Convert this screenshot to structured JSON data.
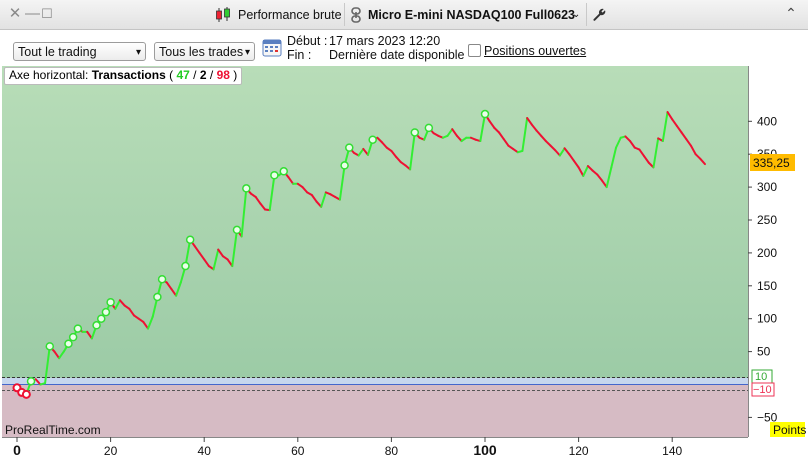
{
  "window": {
    "title": "Performance brute",
    "instrument": "Micro E-mini NASDAQ100 Full0623",
    "controls": [
      "close",
      "minimize",
      "maximize"
    ]
  },
  "toolbar": {
    "trading_select": "Tout le trading",
    "trades_select": "Tous les trades",
    "start_label": "Début :",
    "start_value": "17 mars 2023 12:20",
    "end_label": "Fin :",
    "end_value": "Dernière date disponible",
    "open_positions_label": "Positions ouvertes",
    "open_positions_checked": false
  },
  "chart_header": {
    "label": "Axe horizontal:",
    "mode": "Transactions",
    "paren_open": "(",
    "winners": "47",
    "slash1": "/",
    "neutral": "2",
    "slash2": "/",
    "losers": "98",
    "paren_close": ")"
  },
  "watermark": "ProRealTime.com",
  "units_badge": "Points",
  "colors": {
    "win": "#33ee33",
    "loss": "#ee1133",
    "profit_zone": "#b6ddb6",
    "loss_zone": "#d8bcc4",
    "price_badge": "#ffbb00",
    "units_badge": "#ffff00"
  },
  "chart_data": {
    "type": "line",
    "x_unit": "transactions",
    "y_unit": "Points",
    "current_value_label": "335,25",
    "threshold_labels": [
      "10",
      "−10"
    ],
    "thresholds": [
      10,
      -10
    ],
    "xlim": [
      -2,
      155
    ],
    "ylim": [
      -66,
      455
    ],
    "x_ticks": [
      0,
      20,
      40,
      60,
      80,
      100,
      120,
      140
    ],
    "x_tick_labels": [
      "0",
      "20",
      "40",
      "60",
      "80",
      "100",
      "120",
      "140"
    ],
    "bold_x_ticks": [
      0,
      100
    ],
    "y_ticks": [
      -50,
      50,
      100,
      150,
      200,
      250,
      300,
      350,
      400
    ],
    "y_tick_labels": [
      "−50",
      "50",
      "100",
      "150",
      "200",
      "250",
      "300",
      "350",
      "400"
    ],
    "equity": [
      [
        0,
        -5
      ],
      [
        1,
        -12
      ],
      [
        2,
        -15
      ],
      [
        3,
        5
      ],
      [
        4,
        8
      ],
      [
        5,
        0
      ],
      [
        6,
        2
      ],
      [
        7,
        58
      ],
      [
        8,
        50
      ],
      [
        9,
        40
      ],
      [
        10,
        50
      ],
      [
        11,
        62
      ],
      [
        12,
        72
      ],
      [
        13,
        85
      ],
      [
        14,
        80
      ],
      [
        15,
        80
      ],
      [
        16,
        70
      ],
      [
        17,
        90
      ],
      [
        18,
        100
      ],
      [
        19,
        110
      ],
      [
        20,
        125
      ],
      [
        21,
        115
      ],
      [
        22,
        128
      ],
      [
        23,
        120
      ],
      [
        24,
        115
      ],
      [
        25,
        105
      ],
      [
        26,
        100
      ],
      [
        27,
        95
      ],
      [
        28,
        85
      ],
      [
        29,
        103
      ],
      [
        30,
        133
      ],
      [
        31,
        160
      ],
      [
        32,
        155
      ],
      [
        33,
        145
      ],
      [
        34,
        135
      ],
      [
        35,
        155
      ],
      [
        36,
        180
      ],
      [
        37,
        220
      ],
      [
        38,
        210
      ],
      [
        39,
        200
      ],
      [
        40,
        190
      ],
      [
        41,
        180
      ],
      [
        42,
        175
      ],
      [
        43,
        205
      ],
      [
        44,
        195
      ],
      [
        45,
        190
      ],
      [
        46,
        180
      ],
      [
        47,
        235
      ],
      [
        48,
        225
      ],
      [
        49,
        298
      ],
      [
        50,
        290
      ],
      [
        51,
        285
      ],
      [
        52,
        275
      ],
      [
        53,
        266
      ],
      [
        54,
        265
      ],
      [
        55,
        318
      ],
      [
        56,
        318
      ],
      [
        57,
        324
      ],
      [
        58,
        315
      ],
      [
        59,
        305
      ],
      [
        60,
        305
      ],
      [
        61,
        300
      ],
      [
        62,
        292
      ],
      [
        63,
        288
      ],
      [
        64,
        278
      ],
      [
        65,
        270
      ],
      [
        66,
        292
      ],
      [
        67,
        289
      ],
      [
        68,
        285
      ],
      [
        69,
        281
      ],
      [
        70,
        333
      ],
      [
        71,
        360
      ],
      [
        72,
        352
      ],
      [
        73,
        348
      ],
      [
        74,
        358
      ],
      [
        75,
        349
      ],
      [
        76,
        372
      ],
      [
        77,
        375
      ],
      [
        78,
        368
      ],
      [
        79,
        360
      ],
      [
        80,
        355
      ],
      [
        81,
        346
      ],
      [
        82,
        338
      ],
      [
        83,
        333
      ],
      [
        84,
        327
      ],
      [
        85,
        383
      ],
      [
        86,
        375
      ],
      [
        87,
        372
      ],
      [
        88,
        390
      ],
      [
        89,
        382
      ],
      [
        90,
        378
      ],
      [
        91,
        375
      ],
      [
        92,
        378
      ],
      [
        93,
        388
      ],
      [
        94,
        378
      ],
      [
        95,
        370
      ],
      [
        96,
        375
      ],
      [
        97,
        375
      ],
      [
        98,
        372
      ],
      [
        99,
        370
      ],
      [
        100,
        411
      ],
      [
        101,
        400
      ],
      [
        102,
        390
      ],
      [
        103,
        383
      ],
      [
        104,
        373
      ],
      [
        105,
        363
      ],
      [
        106,
        358
      ],
      [
        107,
        353
      ],
      [
        108,
        355
      ],
      [
        109,
        405
      ],
      [
        110,
        395
      ],
      [
        111,
        386
      ],
      [
        112,
        378
      ],
      [
        113,
        370
      ],
      [
        114,
        363
      ],
      [
        115,
        356
      ],
      [
        116,
        348
      ],
      [
        117,
        359
      ],
      [
        118,
        350
      ],
      [
        119,
        340
      ],
      [
        120,
        330
      ],
      [
        121,
        317
      ],
      [
        122,
        332
      ],
      [
        123,
        325
      ],
      [
        124,
        319
      ],
      [
        125,
        310
      ],
      [
        126,
        300
      ],
      [
        127,
        330
      ],
      [
        128,
        360
      ],
      [
        129,
        375
      ],
      [
        130,
        377
      ],
      [
        131,
        370
      ],
      [
        132,
        360
      ],
      [
        133,
        357
      ],
      [
        134,
        347
      ],
      [
        135,
        337
      ],
      [
        136,
        330
      ],
      [
        137,
        374
      ],
      [
        138,
        370
      ],
      [
        139,
        414
      ],
      [
        140,
        403
      ],
      [
        141,
        393
      ],
      [
        142,
        383
      ],
      [
        143,
        373
      ],
      [
        144,
        363
      ],
      [
        145,
        350
      ],
      [
        146,
        343
      ],
      [
        147,
        335
      ]
    ]
  }
}
